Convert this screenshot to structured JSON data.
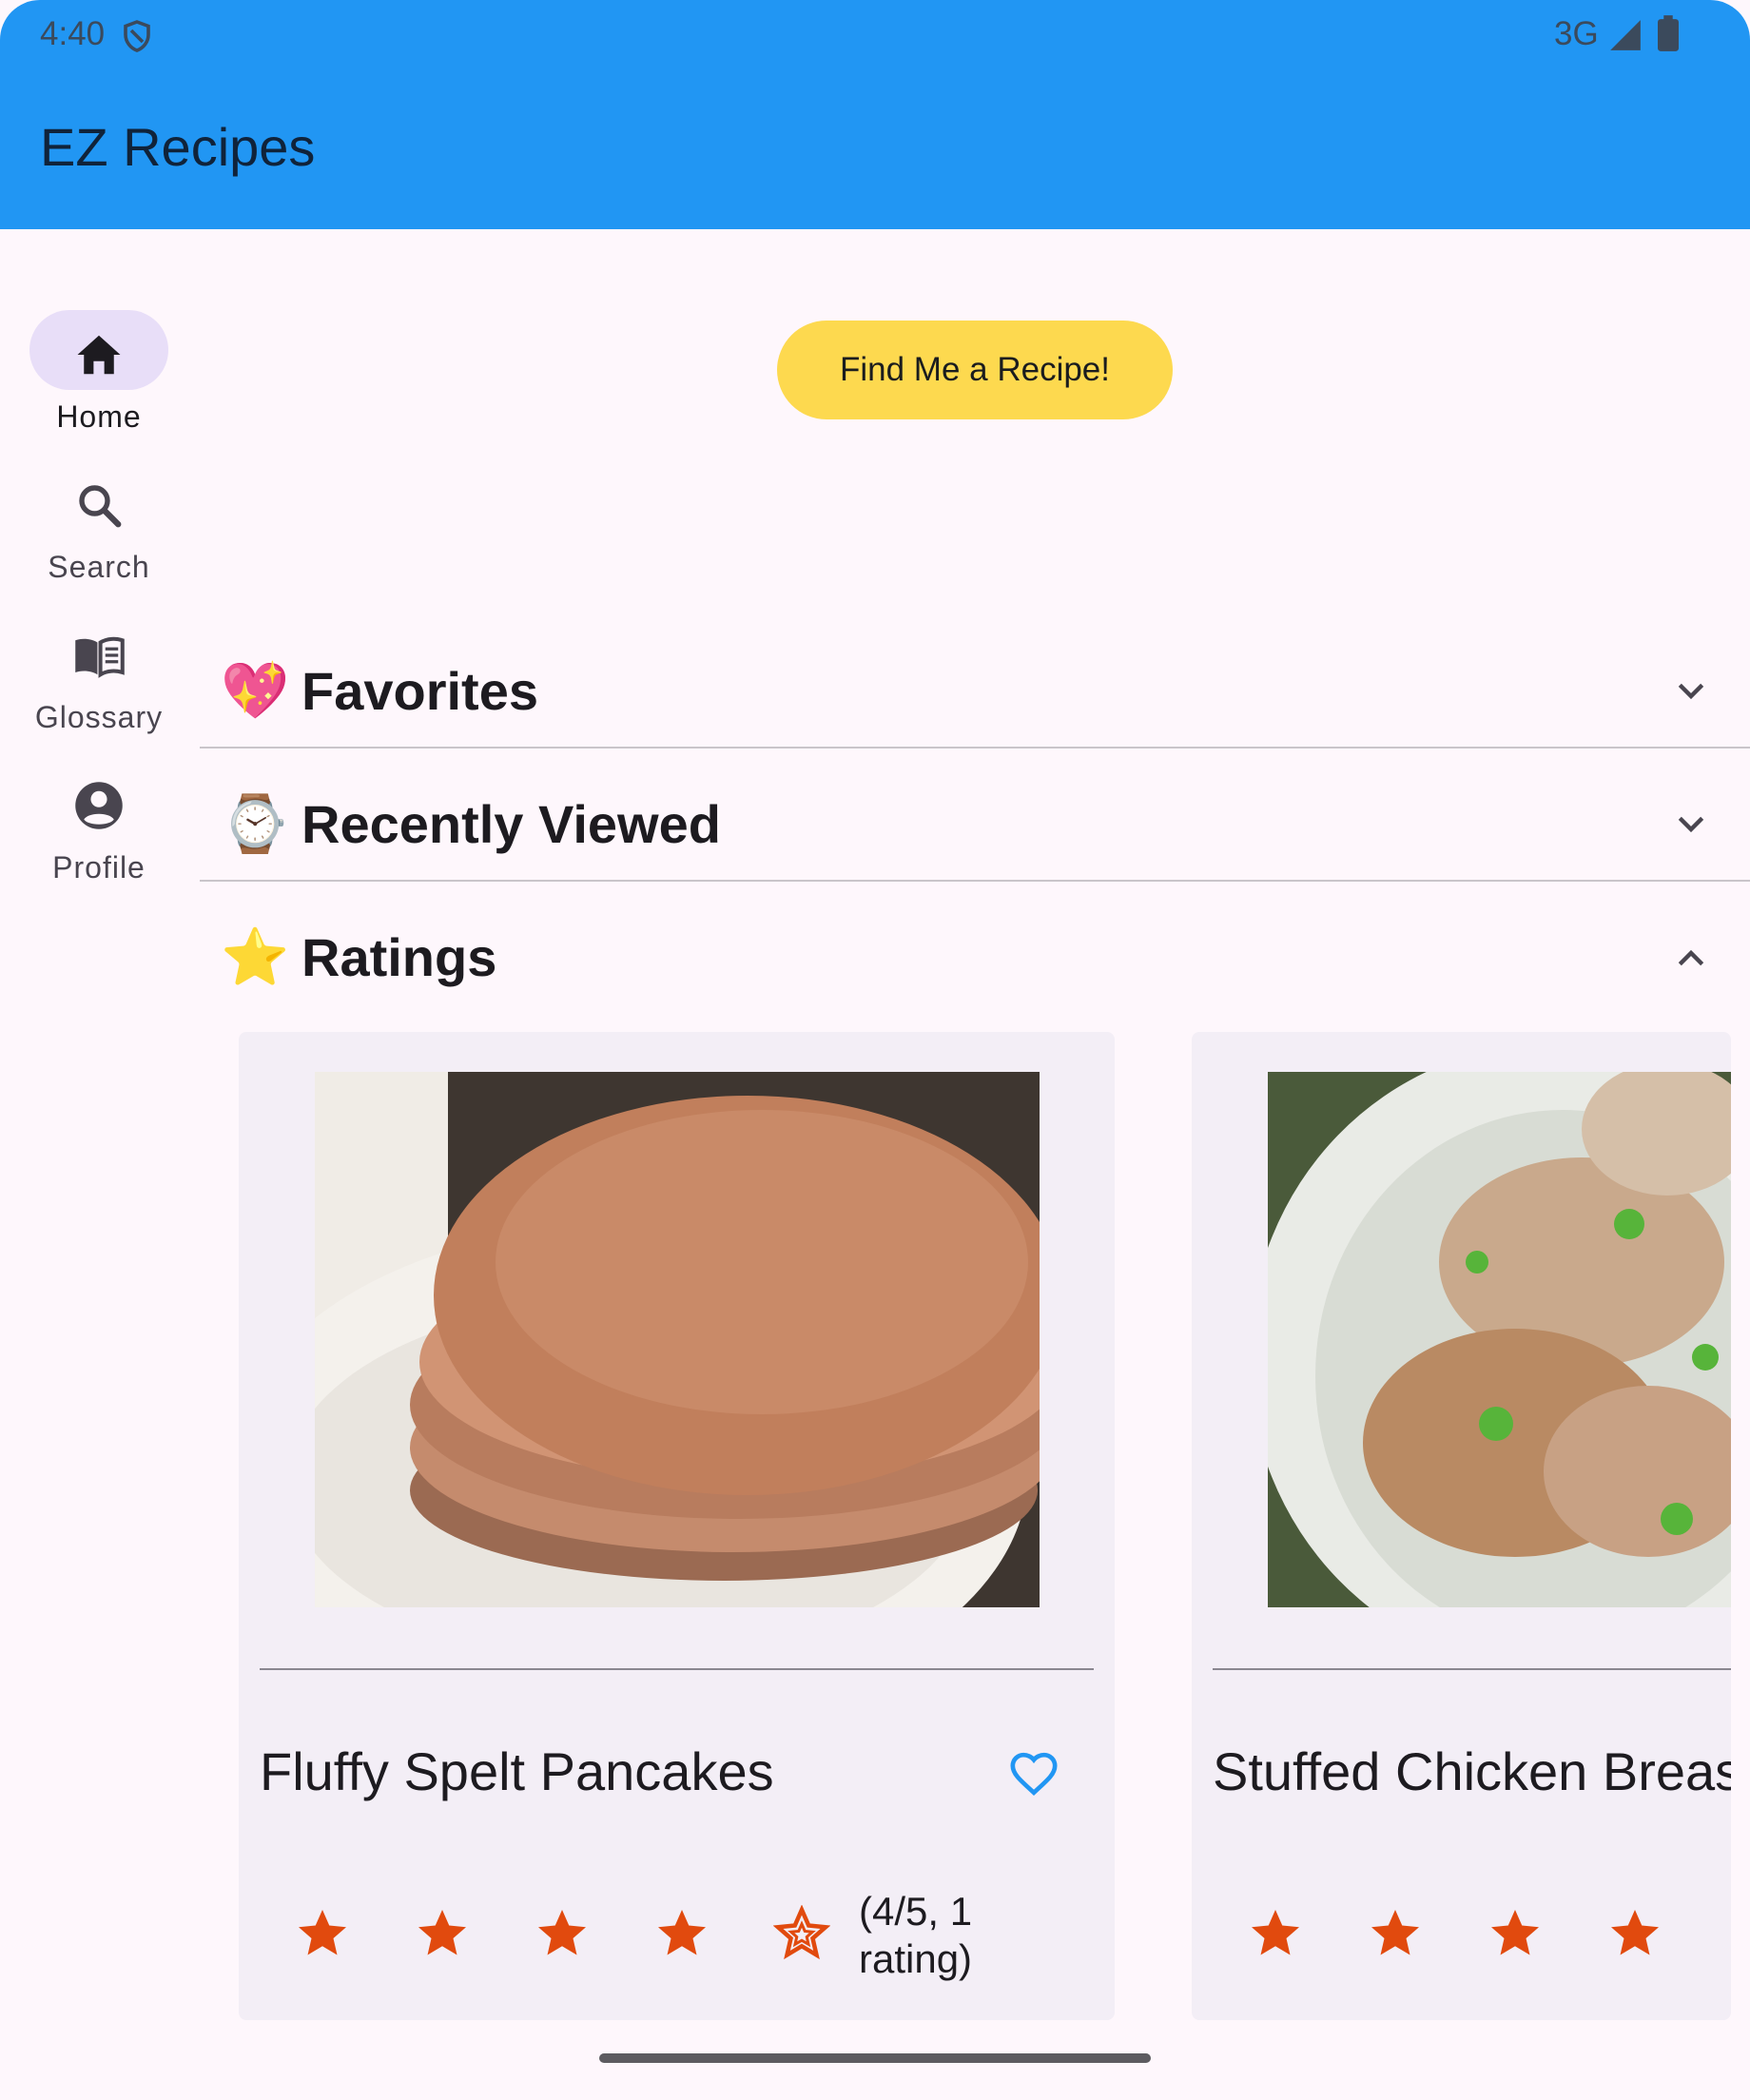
{
  "status_bar": {
    "time": "4:40",
    "network": "3G",
    "icons": [
      "shield-icon",
      "signal-icon",
      "battery-icon"
    ]
  },
  "app_bar": {
    "title": "EZ Recipes",
    "color": "#2196f3"
  },
  "nav_rail": {
    "items": [
      {
        "label": "Home",
        "icon": "home-icon",
        "active": true
      },
      {
        "label": "Search",
        "icon": "search-icon",
        "active": false
      },
      {
        "label": "Glossary",
        "icon": "book-icon",
        "active": false
      },
      {
        "label": "Profile",
        "icon": "account-circle-icon",
        "active": false
      }
    ]
  },
  "main": {
    "find_button_label": "Find Me a Recipe!",
    "sections": [
      {
        "emoji": "💖",
        "title": "Favorites",
        "expanded": false
      },
      {
        "emoji": "⌚",
        "title": "Recently Viewed",
        "expanded": false
      },
      {
        "emoji": "⭐",
        "title": "Ratings",
        "expanded": true
      }
    ],
    "ratings_cards": [
      {
        "title": "Fluffy Spelt Pancakes",
        "rating": 4,
        "rating_text_1": "(4/5, 1",
        "rating_text_2": "rating)",
        "favorite_icon": "heart-outline-icon"
      },
      {
        "title": "Stuffed Chicken Breast",
        "rating": 4
      }
    ]
  },
  "colors": {
    "accent_button": "#fdd94f",
    "star": "#e14a0e",
    "heart": "#2196f3",
    "rail_active": "#e8def8"
  }
}
